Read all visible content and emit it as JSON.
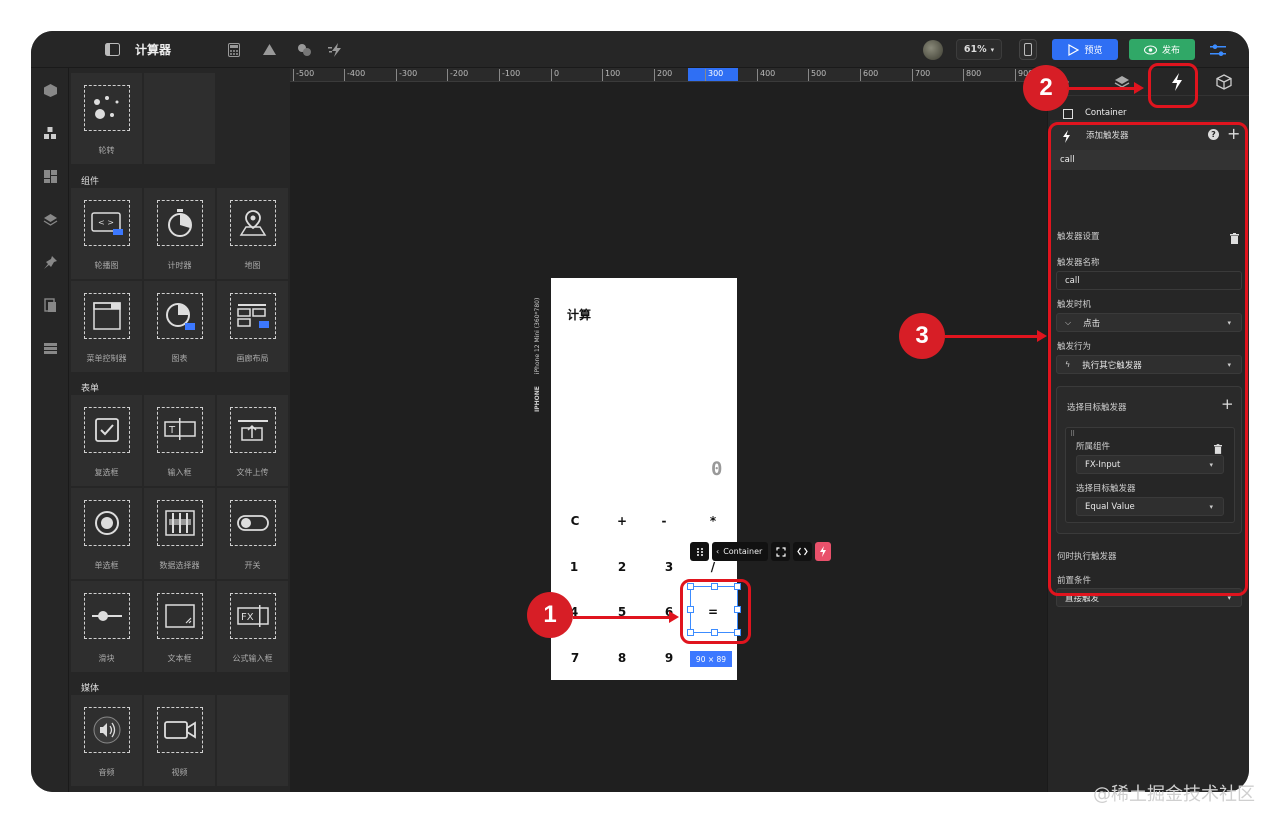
{
  "app": {
    "title": "计算器",
    "zoom": "61%",
    "preview_label": "预览",
    "publish_label": "发布",
    "accent": "#2f6ff4",
    "publish_color": "#30a867",
    "annotation_color": "#e0141e"
  },
  "ruler": {
    "ticks": [
      "-500",
      "-400",
      "-300",
      "-200",
      "-100",
      "0",
      "100",
      "200",
      "300",
      "400",
      "500",
      "600",
      "700",
      "800",
      "900"
    ],
    "highlight": "300"
  },
  "components": {
    "top_tile": "轮转",
    "sections": [
      {
        "title": "组件",
        "items": [
          "轮播图",
          "计时器",
          "地图",
          "菜单控制器",
          "图表",
          "画廊布局"
        ]
      },
      {
        "title": "表单",
        "items": [
          "复选框",
          "输入框",
          "文件上传",
          "单选框",
          "数据选择器",
          "开关",
          "滑块",
          "文本框",
          "公式输入框"
        ]
      },
      {
        "title": "媒体",
        "items": [
          "音频",
          "视频"
        ]
      }
    ]
  },
  "phone": {
    "title": "计算",
    "display": "0",
    "side_label": "iPhone 12 Mini (360*780)",
    "device": "IPHONE",
    "keys": [
      [
        "C",
        "+",
        "-",
        "*"
      ],
      [
        "1",
        "2",
        "3",
        "/"
      ],
      [
        "4",
        "5",
        "6",
        "="
      ],
      [
        "7",
        "8",
        "9",
        ""
      ]
    ],
    "selection_toolbar_label": "Container",
    "size_label": "90 × 89"
  },
  "right_panel": {
    "tabs": [
      "paint-icon",
      "layers-icon",
      "lightning-icon",
      "cube-icon"
    ],
    "selected_component": "Container",
    "add_trigger_label": "添加触发器",
    "trigger_item": "call",
    "trigger_settings_label": "触发器设置",
    "trigger_name_label": "触发器名称",
    "trigger_name_value": "call",
    "trigger_timing_label": "触发时机",
    "trigger_timing_value": "点击",
    "trigger_action_label": "触发行为",
    "trigger_action_value": "执行其它触发器",
    "select_target_label": "选择目标触发器",
    "owner_component_label": "所属组件",
    "owner_component_value": "FX-Input",
    "select_target_trigger_label": "选择目标触发器",
    "select_target_trigger_value": "Equal Value",
    "when_execute_label": "何时执行触发器",
    "precondition_label": "前置条件",
    "precondition_value": "直接触发"
  },
  "annotations": [
    "1",
    "2",
    "3"
  ],
  "watermark": "@稀土掘金技术社区"
}
